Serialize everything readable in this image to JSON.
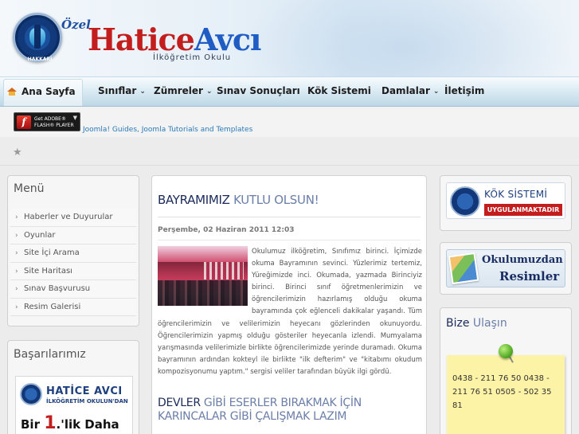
{
  "header": {
    "ozel": "Özel",
    "brand_first": "Hatice",
    "brand_second": "Avcı",
    "subtitle": "İlköğretim Okulu",
    "seal_text": "HAKKARİ"
  },
  "nav": {
    "items": [
      {
        "label": "Ana Sayfa",
        "icon": "home-icon",
        "has_dropdown": false
      },
      {
        "label": "Sınıflar",
        "has_dropdown": true
      },
      {
        "label": "Zümreler",
        "has_dropdown": true
      },
      {
        "label": "Sınav Sonuçları",
        "has_dropdown": false
      },
      {
        "label": "Kök Sistemi",
        "has_dropdown": false
      },
      {
        "label": "Damlalar",
        "has_dropdown": true
      },
      {
        "label": "İletişim",
        "has_dropdown": false
      }
    ],
    "chevron": "⌄"
  },
  "flash": {
    "badge_line1": "Get ADOBE®",
    "badge_line2": "FLASH® PLAYER",
    "link": "Joomla! Guides, Joomla Tutorials and Templates"
  },
  "left": {
    "menu_title": "Menü",
    "menu_items": [
      "Haberler ve Duyurular",
      "Oyunlar",
      "Site İçi Arama",
      "Site Haritası",
      "Sınav Başvurusu",
      "Resim Galerisi"
    ],
    "achievements_title": "Başarılarımız",
    "promo_name": "HATİCE AVCI",
    "promo_sub": "İLKÖĞRETİM OKULUN'DAN",
    "promo_bir": "Bir",
    "promo_one": "1",
    "promo_rest": ".'lik Daha"
  },
  "article": {
    "title_bold": "BAYRAMIMIZ",
    "title_light": " KUTLU OLSUN!",
    "date": "Perşembe, 02 Haziran 2011 12:03",
    "body": "Okulumuz ilköğretim, Sınıfımız birinci. İçimizde okuma Bayramının sevinci. Yüzlerimiz tertemiz, Yüreğimizde inci. Okumada, yazmada Birinciyiz birinci. Birinci sınıf öğretmenlerimizin ve öğrencilerimizin hazırlamış olduğu okuma bayramında çok eğlenceli dakikalar yaşandı. Tüm öğrencilerimizin ve velilerimizin heyecanı gözlerinden okunuyordu. Öğrencilerimizin yapmış olduğu gösteriler heyecanla izlendi. Mumyalama yarışmasında velilerimizle birlikte öğrencilerimizde yerinde duramadı. Okuma bayramının ardından kokteyl ile birlikte \"ilk defterim\" ve \"kitabımı okudum kompozisyonumu yaptım.\" sergisi veliler tarafından büyük ilgi gördü.",
    "second_title_bold": "DEVLER",
    "second_title_light": " GİBİ ESERLER BIRAKMAK İÇİN KARINCALAR GİBİ ÇALIŞMAK LAZIM"
  },
  "right": {
    "kok_line1": "KÖK SİSTEMİ",
    "kok_line2": "UYGULANMAKTADIR",
    "resim_line1": "Okulumuzdan",
    "resim_line2": "Resimler",
    "contact_bold": "Bize",
    "contact_light": " Ulaşın",
    "contact_text": "0438 - 211 76 50 0438 - 211 76 51 0505 - 502 35 81"
  },
  "colors": {
    "brand_red": "#c41d1d",
    "brand_blue": "#1f5cc4",
    "nav_bg": "#d9eaf3",
    "note_yellow": "#fcf3a6",
    "link_blue": "#2a7ab8"
  }
}
